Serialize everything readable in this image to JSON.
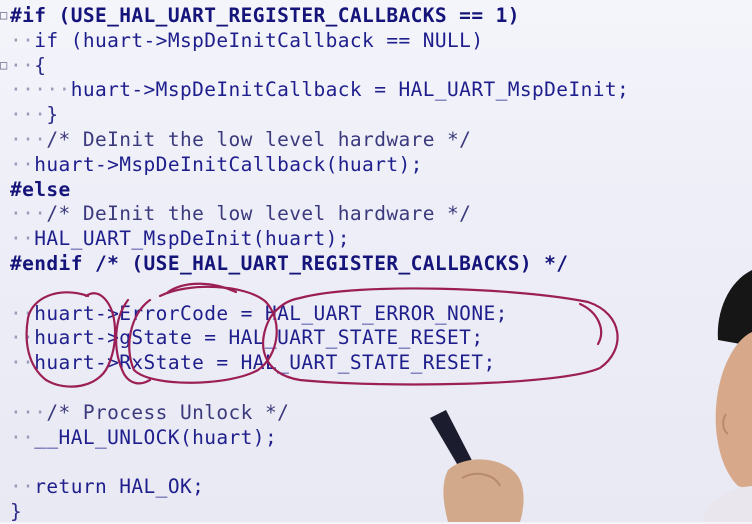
{
  "code_lines": [
    {
      "fold": "□",
      "indent": "",
      "kind": "kw",
      "text": "#if (USE_HAL_UART_REGISTER_CALLBACKS == 1)"
    },
    {
      "fold": "",
      "indent": "··",
      "kind": "code",
      "text": "if (huart->MspDeInitCallback == NULL)"
    },
    {
      "fold": "□",
      "indent": "··",
      "kind": "br",
      "text": "{"
    },
    {
      "fold": "",
      "indent": "·····",
      "kind": "code",
      "text": "huart->MspDeInitCallback = HAL_UART_MspDeInit;"
    },
    {
      "fold": "",
      "indent": "···",
      "kind": "br",
      "text": "}"
    },
    {
      "fold": "",
      "indent": "···",
      "kind": "cm",
      "text": "/* DeInit the low level hardware */"
    },
    {
      "fold": "",
      "indent": "··",
      "kind": "code",
      "text": "huart->MspDeInitCallback(huart);"
    },
    {
      "fold": "",
      "indent": "",
      "kind": "kw",
      "text": "#else"
    },
    {
      "fold": "",
      "indent": "···",
      "kind": "cm",
      "text": "/* DeInit the low level hardware */"
    },
    {
      "fold": "",
      "indent": "··",
      "kind": "code",
      "text": "HAL_UART_MspDeInit(huart);"
    },
    {
      "fold": "",
      "indent": "",
      "kind": "kw",
      "text": "#endif /* (USE_HAL_UART_REGISTER_CALLBACKS) */"
    },
    {
      "fold": "",
      "indent": "",
      "kind": "code",
      "text": ""
    },
    {
      "fold": "",
      "indent": "··",
      "kind": "code",
      "text": "huart->ErrorCode = HAL_UART_ERROR_NONE;"
    },
    {
      "fold": "",
      "indent": "··",
      "kind": "code",
      "text": "huart->gState = HAL_UART_STATE_RESET;"
    },
    {
      "fold": "",
      "indent": "··",
      "kind": "code",
      "text": "huart->RxState = HAL_UART_STATE_RESET;"
    },
    {
      "fold": "",
      "indent": "",
      "kind": "code",
      "text": ""
    },
    {
      "fold": "",
      "indent": "···",
      "kind": "cm",
      "text": "/* Process Unlock */"
    },
    {
      "fold": "",
      "indent": "··",
      "kind": "code",
      "text": "__HAL_UNLOCK(huart);"
    },
    {
      "fold": "",
      "indent": "",
      "kind": "code",
      "text": ""
    },
    {
      "fold": "",
      "indent": "··",
      "kind": "code",
      "text": "return HAL_OK;"
    },
    {
      "fold": "",
      "indent": "",
      "kind": "br",
      "text": "}"
    }
  ],
  "colors": {
    "background": "#eeeef8",
    "code_text": "#1e1e8c",
    "annotation_ink": "#9b1f55",
    "whitespace_dots": "#9a9ab8"
  }
}
